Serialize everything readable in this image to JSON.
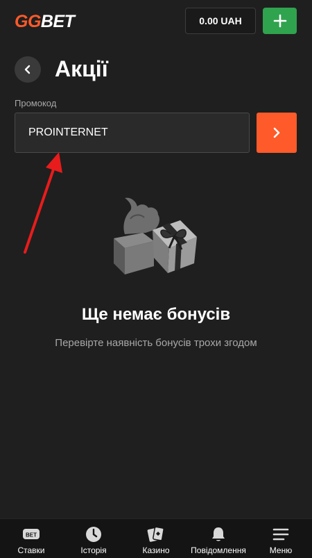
{
  "header": {
    "logo_left": "GG",
    "logo_right": "BET",
    "balance": "0.00 UAH",
    "brand_color": "#ff5a2a",
    "deposit_color": "#2fa34e"
  },
  "page": {
    "title": "Акції"
  },
  "promo": {
    "label": "Промокод",
    "value": "PROINTERNET"
  },
  "empty_state": {
    "title": "Ще немає бонусів",
    "subtitle": "Перевірте наявність бонусів трохи згодом"
  },
  "bottom_nav": {
    "items": [
      {
        "label": "Ставки",
        "icon": "bet-ticket-icon"
      },
      {
        "label": "Історія",
        "icon": "clock-icon"
      },
      {
        "label": "Казино",
        "icon": "cards-icon"
      },
      {
        "label": "Повідомлення",
        "icon": "bell-icon"
      },
      {
        "label": "Меню",
        "icon": "hamburger-icon"
      }
    ]
  },
  "colors": {
    "background": "#1f1f1f",
    "annotation_arrow": "#e81c1c"
  }
}
